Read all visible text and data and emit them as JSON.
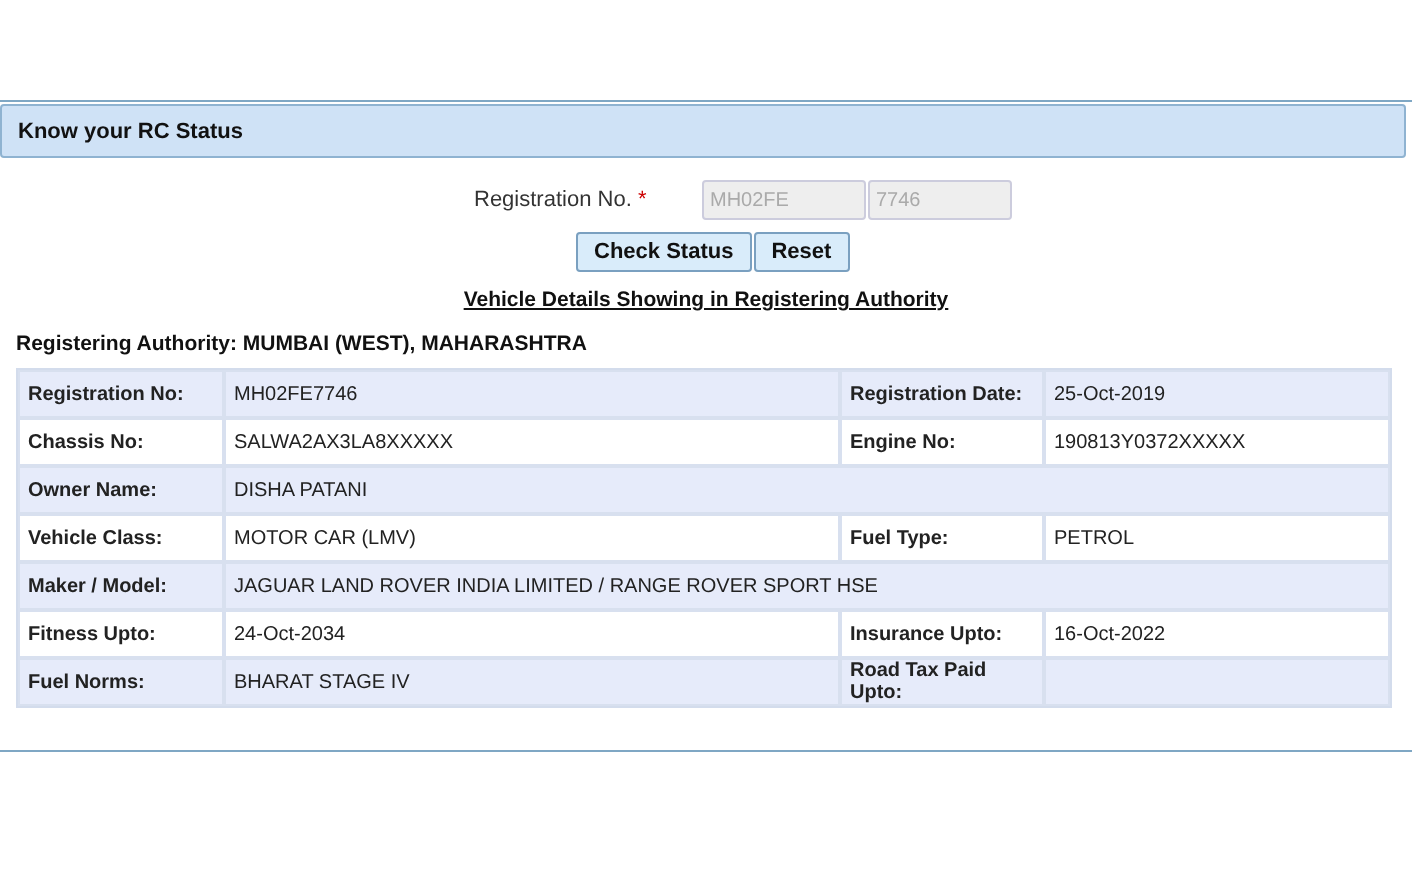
{
  "panel": {
    "title": "Know your RC Status"
  },
  "form": {
    "label": "Registration No.",
    "required_mark": "*",
    "fields": [
      {
        "value": "MH02FE",
        "disabled": true
      },
      {
        "value": "7746",
        "disabled": true
      }
    ],
    "buttons": [
      "Check Status",
      "Reset"
    ]
  },
  "details_link": "Vehicle Details Showing in Registering Authority",
  "authority": "Registering Authority: MUMBAI (WEST), MAHARASHTRA",
  "table": {
    "rows": [
      {
        "pairs": [
          {
            "label": "Registration No:",
            "value": "MH02FE7746"
          },
          {
            "label": "Registration Date:",
            "value": "25-Oct-2019"
          }
        ]
      },
      {
        "pairs": [
          {
            "label": "Chassis No:",
            "value": "SALWA2AX3LA8XXXXX"
          },
          {
            "label": "Engine No:",
            "value": "190813Y0372XXXXX"
          }
        ]
      },
      {
        "pairs": [
          {
            "label": "Owner Name:",
            "value": "DISHA PATANI"
          }
        ]
      },
      {
        "pairs": [
          {
            "label": "Vehicle Class:",
            "value": "MOTOR CAR (LMV)"
          },
          {
            "label": "Fuel Type:",
            "value": "PETROL"
          }
        ]
      },
      {
        "pairs": [
          {
            "label": "Maker / Model:",
            "value": "JAGUAR LAND ROVER INDIA LIMITED / RANGE ROVER SPORT HSE"
          }
        ]
      },
      {
        "pairs": [
          {
            "label": "Fitness Upto:",
            "value": "24-Oct-2034"
          },
          {
            "label": "Insurance Upto:",
            "value": "16-Oct-2022"
          }
        ]
      },
      {
        "pairs": [
          {
            "label": "Fuel Norms:",
            "value": "BHARAT STAGE IV"
          },
          {
            "label": "Road Tax Paid Upto:"
          }
        ]
      }
    ]
  }
}
